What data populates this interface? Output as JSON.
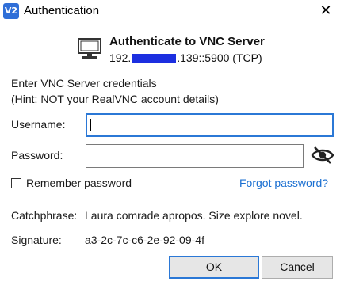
{
  "window": {
    "icon_text": "V2",
    "title": "Authentication",
    "close_glyph": "✕"
  },
  "header": {
    "icon": "monitor-icon",
    "title": "Authenticate to VNC Server",
    "address_prefix": "192.",
    "address_suffix": ".139::5900 (TCP)"
  },
  "intro": {
    "line1": "Enter VNC Server credentials",
    "line2": "(Hint: NOT your RealVNC account details)"
  },
  "form": {
    "username_label": "Username:",
    "username_value": "",
    "password_label": "Password:",
    "password_value": "",
    "eye_icon": "eye-slash-icon",
    "remember_label": "Remember password",
    "remember_checked": false,
    "forgot_link": "Forgot password?"
  },
  "details": {
    "catchphrase_label": "Catchphrase:",
    "catchphrase_value": "Laura comrade apropos. Size explore novel.",
    "signature_label": "Signature:",
    "signature_value": "a3-2c-7c-c6-2e-92-09-4f"
  },
  "buttons": {
    "ok": "OK",
    "cancel": "Cancel"
  },
  "colors": {
    "accent": "#2b78d6",
    "link": "#1a6fd1",
    "redaction": "#1c2fe0"
  }
}
